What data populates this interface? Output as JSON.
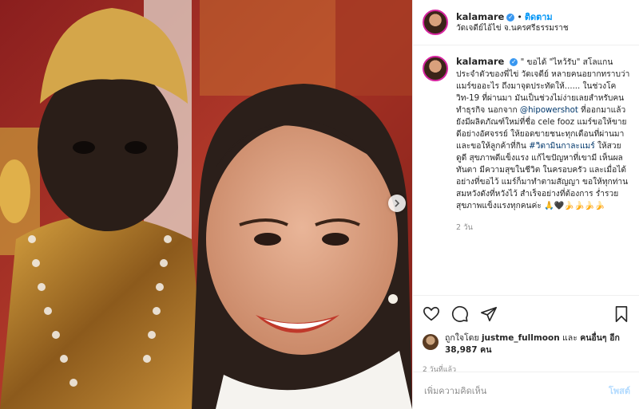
{
  "header": {
    "username": "kalamare",
    "separator": "•",
    "follow_label": "ติดตาม",
    "location": "วัดเจดีย์ไอ้ไข่ จ.นครศรีธรรมราช"
  },
  "caption": {
    "username": "kalamare",
    "text_1": "\" ขอได้ \"ไหว้รับ\" สโลแกนประจำตัวของพี่ไข่ วัดเจดีย์ หลายคนอยากทราบว่าแมร์ขออะไร ถึงมาจุดประทัดให้...... ในช่วงโควิท-19 ที่ผ่านมา มันเป็นช่วงไม่ง่ายเลยสำหรับคนทำธุรกิจ นอกจาก",
    "mention": "@hipowershot",
    "text_2": " ที่ออกมาแล้ว ยังมีผลิตภัณฑ์ใหม่ที่ชื่อ cele fooz แมร์ขอให้ขายดีอย่างอัศจรรย์ ให้ยอดขายชนะทุกเดือนที่ผ่านมา และขอให้ลูกค้าที่กิน ",
    "hashtag": "#วิตามินกาละแมร์",
    "text_3": " ให้สวย ดูดี สุขภาพดีแข็งแรง แก้ไขปัญหาที่เขามี เห็นผลทันตา มีความสุขในชีวิต ในครอบครัว และเมื่อได้อย่างที่ขอไว้ แมร์ก็มาทำตามสัญญา ขอให้ทุกท่าน สมหวังดังที่หวังไว้ สำเร็จอย่างที่ต้องการ ร่ำรวย สุขภาพแข็งแรงทุกคนค่ะ 🙏🖤🍌🍌🍌🍌",
    "time": "2 วัน"
  },
  "likes": {
    "prefix": "ถูกใจโดย ",
    "liker": "justme_fullmoon",
    "mid": " และ ",
    "others": "คนอื่นๆ อีก 38,987 คน"
  },
  "posted_ago": "2 วันที่แล้ว",
  "comment_box": {
    "placeholder": "เพิ่มความคิดเห็น",
    "post_label": "โพสต์"
  },
  "icons": {
    "like": "heart-icon",
    "comment": "comment-icon",
    "share": "share-icon",
    "save": "bookmark-icon",
    "next": "chevron-right-icon"
  },
  "colors": {
    "link_blue": "#0095f6",
    "mention": "#00376b",
    "muted": "#8e8e8e",
    "border": "#efefef"
  }
}
